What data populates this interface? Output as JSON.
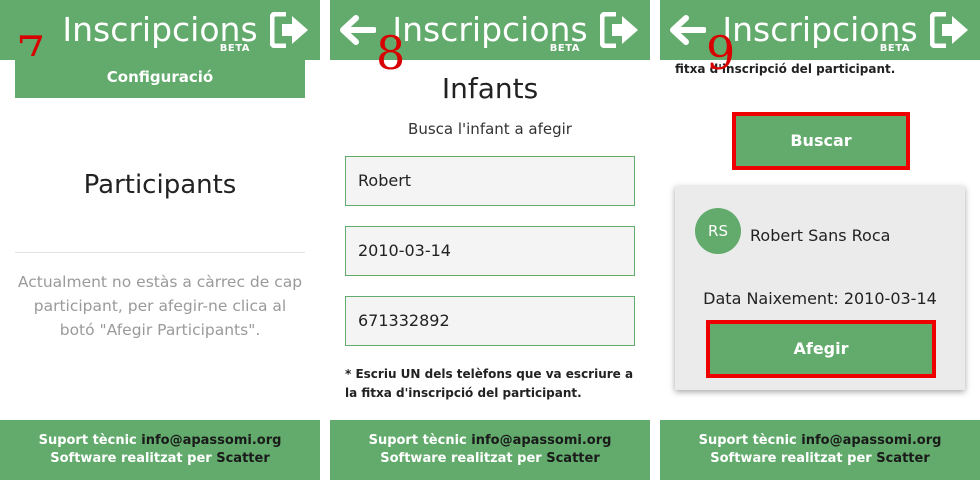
{
  "colors": {
    "brand_green": "#62ab6c",
    "highlight_red": "#ee0000",
    "marker_red": "#d80000"
  },
  "header": {
    "title": "Inscripcions",
    "beta": "BETA",
    "logout_icon": "logout-arrow-icon",
    "back_icon": "back-arrow-icon"
  },
  "footer": {
    "line1_prefix": "Suport tècnic ",
    "email": "info@apassomi.org",
    "line2_prefix": "Software realitzat per ",
    "company": "Scatter"
  },
  "panels": {
    "p7": {
      "marker": "7",
      "config_button": "Configuració",
      "heading": "Participants",
      "empty_message": "Actualment no estàs a càrrec de cap participant, per afegir-ne clica al botó \"Afegir Participants\"."
    },
    "p8": {
      "marker": "8",
      "title": "Infants",
      "subtitle": "Busca l'infant a afegir",
      "field_name": "Robert",
      "field_birthdate": "2010-03-14",
      "field_phone": "671332892",
      "note": "* Escriu UN dels telèfons que va escriure a la fitxa d'inscripció del participant."
    },
    "p9": {
      "marker": "9",
      "note_tail": "fitxa d'inscripció del participant.",
      "search_button": "Buscar",
      "result": {
        "initials": "RS",
        "name": "Robert Sans Roca",
        "birth": "Data Naixement: 2010-03-14",
        "add_button": "Afegir"
      }
    }
  }
}
